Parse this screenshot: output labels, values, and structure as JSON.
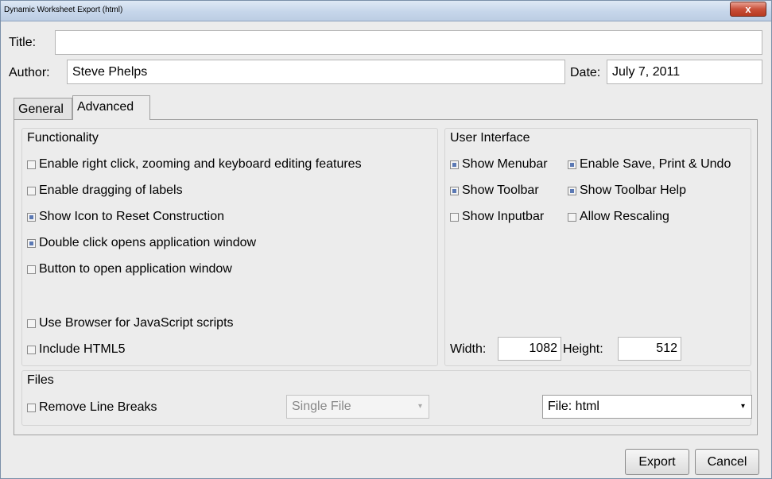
{
  "window": {
    "title": "Dynamic Worksheet Export (html)",
    "close_label": "x"
  },
  "header": {
    "title_label": "Title:",
    "title_value": "",
    "author_label": "Author:",
    "author_value": "Steve Phelps",
    "date_label": "Date:",
    "date_value": "July 7, 2011"
  },
  "tabs": [
    {
      "label": "General",
      "active": false
    },
    {
      "label": "Advanced",
      "active": true
    }
  ],
  "functionality": {
    "title": "Functionality",
    "items": [
      {
        "label": "Enable right click, zooming and keyboard editing features",
        "checked": false
      },
      {
        "label": "Enable dragging of labels",
        "checked": false
      },
      {
        "label": "Show Icon to Reset Construction",
        "checked": true
      },
      {
        "label": "Double click opens application window",
        "checked": true
      },
      {
        "label": "Button to open application window",
        "checked": false
      },
      {
        "label": "Use Browser for JavaScript scripts",
        "checked": false
      },
      {
        "label": "Include HTML5",
        "checked": false
      }
    ]
  },
  "user_interface": {
    "title": "User Interface",
    "items": [
      {
        "label": "Show Menubar",
        "checked": true
      },
      {
        "label": "Enable Save, Print & Undo",
        "checked": true
      },
      {
        "label": "Show Toolbar",
        "checked": true
      },
      {
        "label": "Show Toolbar Help",
        "checked": true
      },
      {
        "label": "Show Inputbar",
        "checked": false
      },
      {
        "label": "Allow Rescaling",
        "checked": false
      }
    ],
    "width_label": "Width:",
    "width_value": "1082",
    "height_label": "Height:",
    "height_value": "512"
  },
  "files": {
    "title": "Files",
    "remove_line_breaks": {
      "label": "Remove Line Breaks",
      "checked": false
    },
    "file_mode": "Single File",
    "file_type": "File: html"
  },
  "buttons": {
    "export": "Export",
    "cancel": "Cancel"
  }
}
